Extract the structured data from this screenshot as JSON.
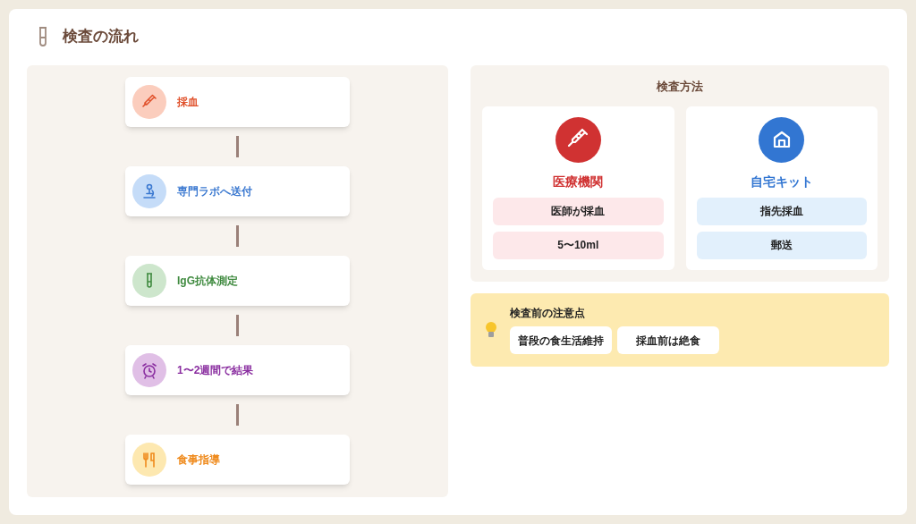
{
  "title": "検査の流れ",
  "steps": [
    {
      "label": "採血"
    },
    {
      "label": "専門ラボへ送付"
    },
    {
      "label": "IgG抗体測定"
    },
    {
      "label": "1〜2週間で結果"
    },
    {
      "label": "食事指導"
    }
  ],
  "methods": {
    "title": "検査方法",
    "cards": [
      {
        "name": "医療機関",
        "items": [
          "医師が採血",
          "5〜10ml"
        ]
      },
      {
        "name": "自宅キット",
        "items": [
          "指先採血",
          "郵送"
        ]
      }
    ]
  },
  "notes": {
    "title": "検査前の注意点",
    "items": [
      "普段の食生活維持",
      "採血前は絶食"
    ]
  }
}
